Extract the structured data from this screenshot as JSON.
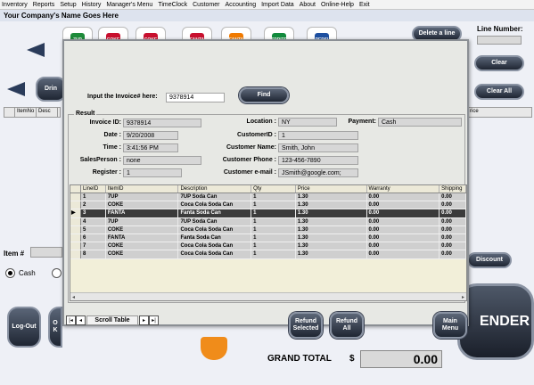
{
  "menu": [
    "Inventory",
    "Reports",
    "Setup",
    "History",
    "Manager's Menu",
    "TimeClock",
    "Customer",
    "Accounting",
    "Import Data",
    "About",
    "Online-Help",
    "Exit"
  ],
  "company_title": "Your Company's Name Goes Here",
  "background": {
    "line_number_label": "Line Number:",
    "delete_line": "Delete a line",
    "clear": "Clear",
    "clear_all": "Clear All",
    "grid_col_item": "ItemNo",
    "grid_col_desc": "Desc",
    "grid_col_price": "rice",
    "item_label": "Item #",
    "payment_cash": "Cash",
    "discount": "Discount",
    "log_out": "Log-Out",
    "tender": "ENDER",
    "grand_total_label": "GRAND TOTAL",
    "currency": "$",
    "grand_total_value": "0.00",
    "partial_btn_1": "Drin",
    "partial_btn_2": "O K",
    "products": [
      {
        "label": "7UP",
        "color": "#1e8b3a"
      },
      {
        "label": "COKE",
        "color": "#c8102e"
      },
      {
        "label": "COKE",
        "color": "#c8102e"
      },
      {
        "label": "FANTA",
        "color": "#c8102e"
      },
      {
        "label": "FANTA",
        "color": "#f07a00"
      },
      {
        "label": "SPRITE",
        "color": "#118a3c"
      },
      {
        "label": "PEPSI",
        "color": "#1d4fa0"
      }
    ]
  },
  "modal": {
    "invoice_prompt": "Input the Invoice# here:",
    "invoice_input": "9378914",
    "find": "Find",
    "result_title": "Result",
    "fields": {
      "invoice_id_label": "Invoice ID:",
      "invoice_id": "9378914",
      "date_label": "Date :",
      "date": "9/20/2008",
      "time_label": "Time :",
      "time": "3:41:56 PM",
      "salesperson_label": "SalesPerson :",
      "salesperson": "none",
      "register_label": "Register :",
      "register": "1",
      "location_label": "Location :",
      "location": "NY",
      "payment_label": "Payment:",
      "payment": "Cash",
      "customer_id_label": "CustomerID :",
      "customer_id": "1",
      "customer_name_label": "Customer Name:",
      "customer_name": "Smith, John",
      "customer_phone_label": "Customer Phone :",
      "customer_phone": "123-456-7890",
      "customer_email_label": "Customer e-mail :",
      "customer_email": "JSmith@google.com;"
    },
    "table": {
      "headers": [
        "LineID",
        "ItemID",
        "Description",
        "Qty",
        "Price",
        "Warranty",
        "Shipping"
      ],
      "rows": [
        [
          "1",
          "7UP",
          "7UP Soda Can",
          "1",
          "1.30",
          "0.00",
          "0.00"
        ],
        [
          "2",
          "COKE",
          "Coca Cola Soda Can",
          "1",
          "1.30",
          "0.00",
          "0.00"
        ],
        [
          "3",
          "FANTA",
          "Fanta Soda Can",
          "1",
          "1.30",
          "0.00",
          "0.00"
        ],
        [
          "4",
          "7UP",
          "7UP Soda Can",
          "1",
          "1.30",
          "0.00",
          "0.00"
        ],
        [
          "5",
          "COKE",
          "Coca Cola Soda Can",
          "1",
          "1.30",
          "0.00",
          "0.00"
        ],
        [
          "6",
          "FANTA",
          "Fanta Soda Can",
          "1",
          "1.30",
          "0.00",
          "0.00"
        ],
        [
          "7",
          "COKE",
          "Coca Cola Soda Can",
          "1",
          "1.30",
          "0.00",
          "0.00"
        ],
        [
          "8",
          "COKE",
          "Coca Cola Soda Can",
          "1",
          "1.30",
          "0.00",
          "0.00"
        ]
      ],
      "selected_row": 2
    },
    "scroll_label": "Scroll Table",
    "refund_selected": "Refund Selected",
    "refund_all": "Refund All",
    "main_menu": "Main Menu"
  }
}
